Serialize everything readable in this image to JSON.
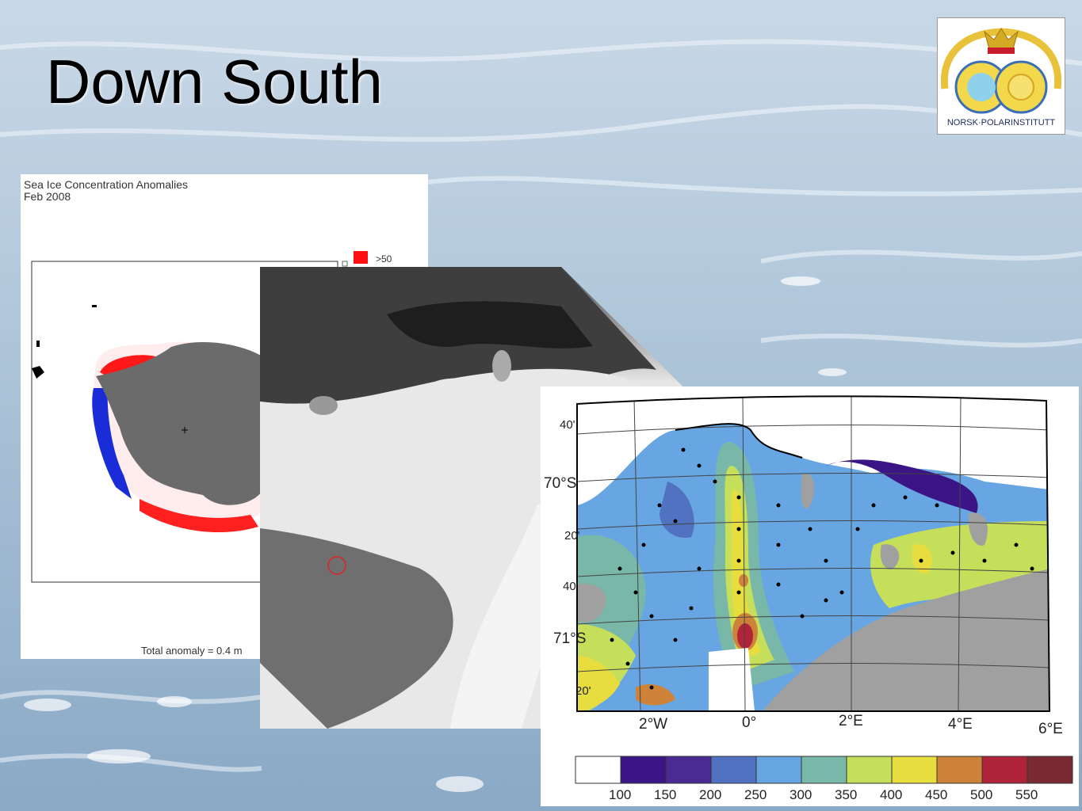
{
  "slide": {
    "title": "Down South"
  },
  "logo": {
    "text": "NORSK·POLARINSTITUTT"
  },
  "sea_ice_panel": {
    "title_line1": "Sea Ice Concentration Anomalies",
    "title_line2": "Feb 2008",
    "legend_top_label": ">50",
    "total_anomaly": "Total anomaly =  0.4 m"
  },
  "depth_map": {
    "y_labels": [
      "40'",
      "70°S",
      "20'",
      "40'",
      "71°S",
      "20'"
    ],
    "x_labels": [
      "2°W",
      "0°",
      "2°E",
      "4°E",
      "6°E"
    ],
    "colorbar_labels": [
      "100",
      "150",
      "200",
      "250",
      "300",
      "350",
      "400",
      "450",
      "500",
      "550"
    ],
    "colorbar_colors": [
      "#ffffff",
      "#3b1586",
      "#4a2a93",
      "#5172c0",
      "#67a6e2",
      "#79b8a8",
      "#c6df5a",
      "#e8dd3e",
      "#cd843a",
      "#b0243a",
      "#7b2a33"
    ]
  }
}
